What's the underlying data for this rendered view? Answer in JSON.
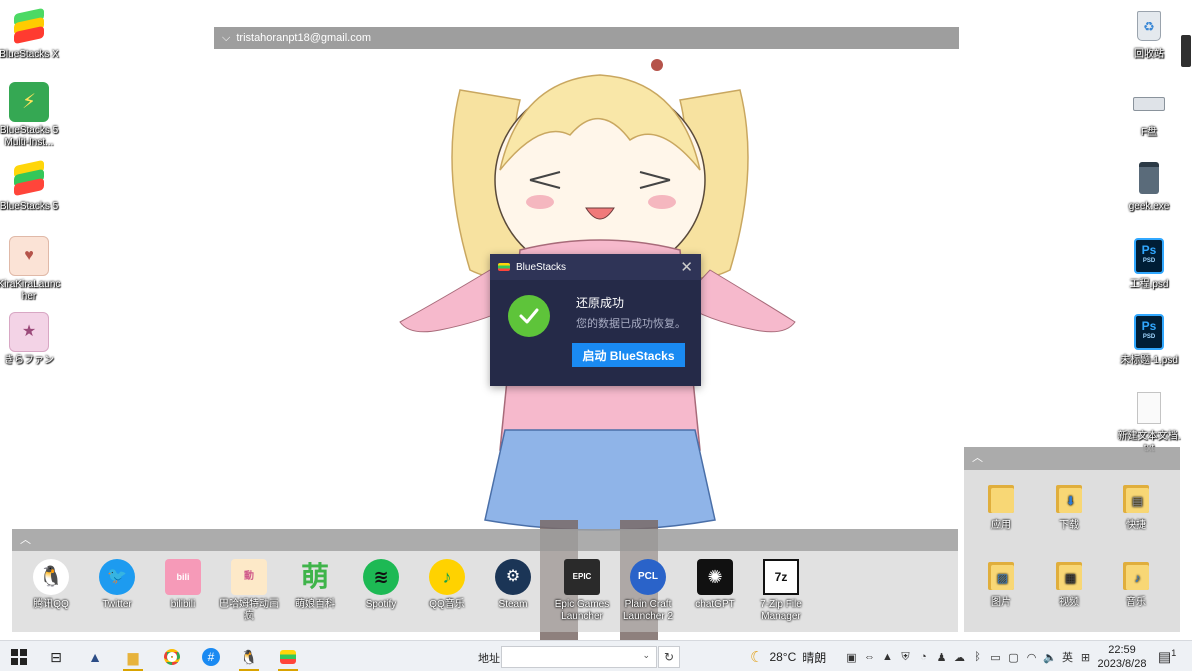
{
  "desktop_left_icons": [
    {
      "label": "BlueStacks X"
    },
    {
      "label": "BlueStacks 5 Multi-Inst..."
    },
    {
      "label": "BlueStacks 5"
    },
    {
      "label": "KiraKiraLauncher"
    },
    {
      "label": "きらファン"
    }
  ],
  "desktop_right_icons": [
    {
      "label": "回收站"
    },
    {
      "label": "F盘"
    },
    {
      "label": "geek.exe"
    },
    {
      "label": "工程.psd"
    },
    {
      "label": "未标题-1.psd"
    },
    {
      "label": "新建文本文档.txt"
    }
  ],
  "account_bar": {
    "email": "tristahoranpt18@gmail.com"
  },
  "dock": {
    "items": [
      {
        "label": "腾讯QQ"
      },
      {
        "label": "Twitter"
      },
      {
        "label": "bilibili"
      },
      {
        "label": "巴哈姆特动画疯"
      },
      {
        "label": "萌娘百科"
      },
      {
        "label": "Spotify"
      },
      {
        "label": "QQ音乐"
      },
      {
        "label": "Steam"
      },
      {
        "label": "Epic Games Launcher"
      },
      {
        "label": "Plain Craft Launcher 2"
      },
      {
        "label": "chatGPT"
      },
      {
        "label": "7-Zip File Manager"
      }
    ]
  },
  "folder_panel": {
    "items": [
      {
        "label": "应用"
      },
      {
        "label": "下载"
      },
      {
        "label": "快捷"
      },
      {
        "label": "图片"
      },
      {
        "label": "视频"
      },
      {
        "label": "音乐"
      }
    ]
  },
  "dialog": {
    "title": "BlueStacks",
    "heading": "还原成功",
    "message": "您的数据已成功恢复。",
    "button": "启动 BlueStacks"
  },
  "taskbar": {
    "address_label": "地址",
    "address_value": "",
    "weather": {
      "temp": "28°C",
      "condition": "晴朗"
    },
    "ime": "英",
    "time": "22:59",
    "date": "2023/8/28",
    "notifications": "1"
  },
  "colors": {
    "accent": "#1a8af2",
    "dialog_bg": "#252a48",
    "success": "#5ec43a"
  }
}
